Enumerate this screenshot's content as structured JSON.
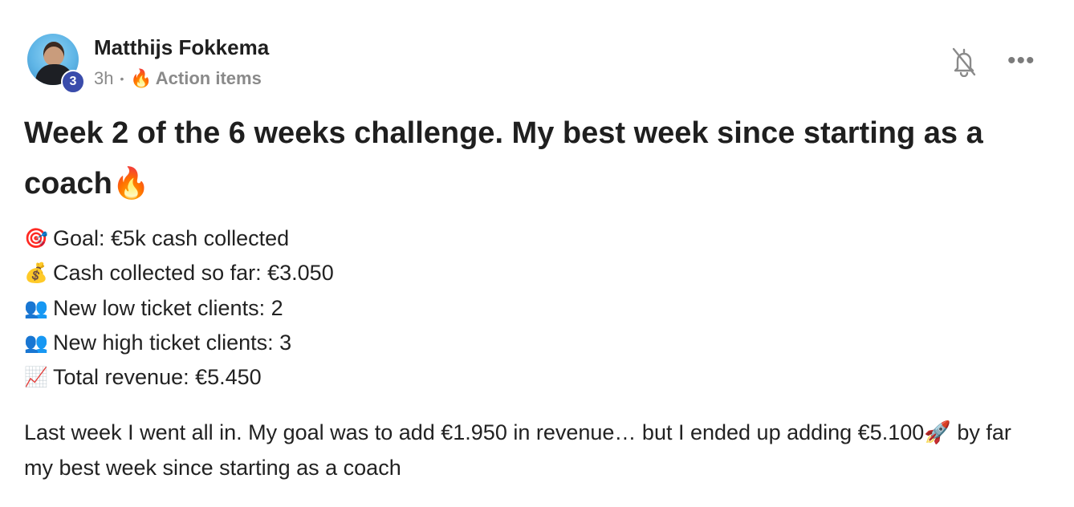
{
  "post": {
    "author": "Matthijs Fokkema",
    "level": "3",
    "time": "3h",
    "separator": "•",
    "category_emoji": "🔥",
    "category": "Action items",
    "title": "Week 2 of the 6 weeks challenge. My best week since starting as a coach🔥",
    "stats": [
      {
        "emoji": "🎯",
        "text": "Goal: €5k cash collected"
      },
      {
        "emoji": "💰",
        "text": "Cash collected so far: €3.050"
      },
      {
        "emoji": "👥",
        "text": "New low ticket clients: 2"
      },
      {
        "emoji": "👥",
        "text": "New high ticket clients: 3"
      },
      {
        "emoji": "📈",
        "text": "Total revenue: €5.450"
      }
    ],
    "body": "Last week I went all in. My goal was to add €1.950 in revenue… but I ended up adding €5.100🚀 by far my best week since starting as a coach"
  },
  "icons": {
    "notify": "bell-off-icon",
    "menu": "more-horizontal-icon"
  },
  "colors": {
    "level_badge": "#3a4cab",
    "meta_text": "#8a8a8a",
    "title_text": "#1f1f1f"
  }
}
